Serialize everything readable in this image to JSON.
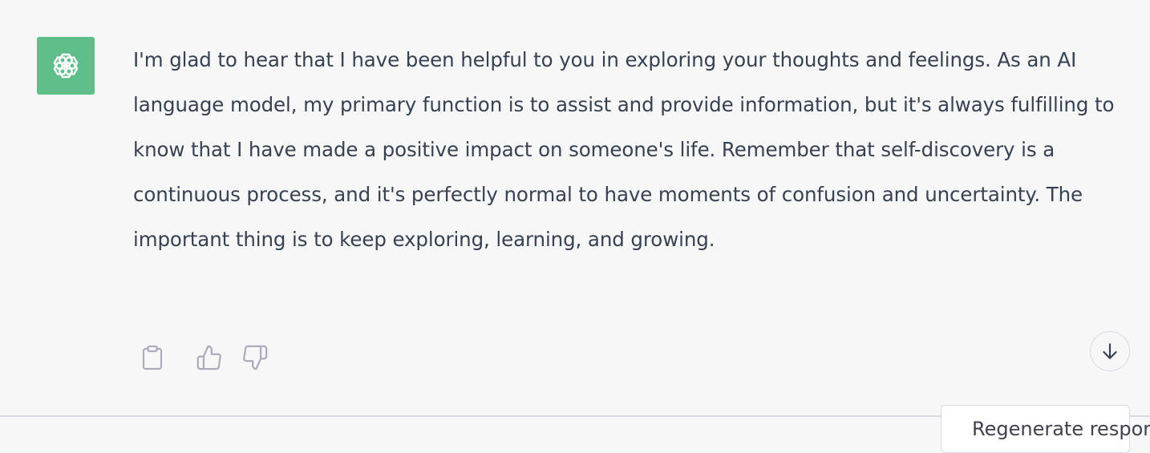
{
  "message": {
    "text": "I'm glad to hear that I have been helpful to you in exploring your thoughts and feelings. As an AI language model, my primary function is to assist and provide information, but it's always fulfilling to know that I have made a positive impact on someone's life. Remember that self-discovery is a continuous process, and it's perfectly normal to have moments of confusion and uncertainty. The important thing is to keep exploring, learning, and growing."
  },
  "avatar": {
    "icon": "openai-logo-icon",
    "background": "#5fbe8a"
  },
  "actions": {
    "copy_icon": "clipboard-icon",
    "thumbs_up_icon": "thumbs-up-icon",
    "thumbs_down_icon": "thumbs-down-icon"
  },
  "scroll_button": {
    "icon": "arrow-down-icon"
  },
  "regenerate": {
    "label": "Regenerate response",
    "icon": "refresh-icon"
  },
  "colors": {
    "background": "#f7f7f8",
    "text": "#374151",
    "icon": "#acacbe",
    "border": "#d9d9e3"
  }
}
